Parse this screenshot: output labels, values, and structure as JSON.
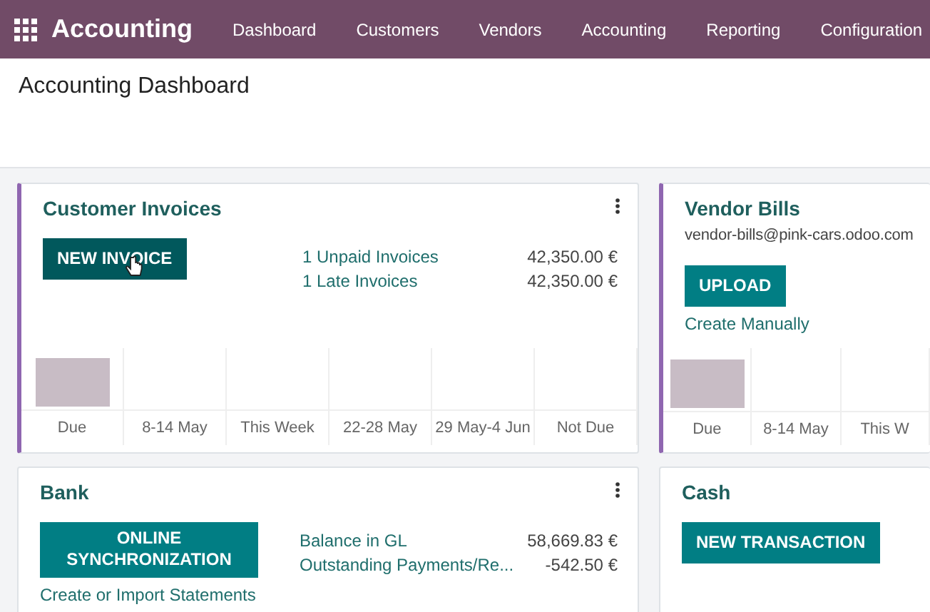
{
  "navbar": {
    "app_name": "Accounting",
    "menu": [
      "Dashboard",
      "Customers",
      "Vendors",
      "Accounting",
      "Reporting",
      "Configuration"
    ]
  },
  "page_title": "Accounting Dashboard",
  "journals": [
    {
      "name": "Customer Invoices",
      "accent": true,
      "has_menu": true,
      "buttons": [
        {
          "label": "NEW INVOICE",
          "hovered": true
        }
      ],
      "stats": [
        {
          "label": "1 Unpaid Invoices",
          "value": "42,350.00 €"
        },
        {
          "label": "1 Late Invoices",
          "value": "42,350.00 €"
        }
      ],
      "graph": [
        {
          "label": "Due",
          "bar": true
        },
        {
          "label": "8-14 May",
          "bar": false
        },
        {
          "label": "This Week",
          "bar": false
        },
        {
          "label": "22-28 May",
          "bar": false
        },
        {
          "label": "29 May-4 Jun",
          "bar": false
        },
        {
          "label": "Not Due",
          "bar": false
        }
      ]
    },
    {
      "name": "Vendor Bills",
      "subtitle": "vendor-bills@pink-cars.odoo.com",
      "accent": true,
      "buttons": [
        {
          "label": "UPLOAD",
          "hovered": false
        }
      ],
      "links": [
        "Create Manually"
      ],
      "graph": [
        {
          "label": "Due",
          "bar": true
        },
        {
          "label": "8-14 May",
          "bar": false
        },
        {
          "label": "This W",
          "bar": false
        }
      ]
    },
    {
      "name": "Bank",
      "accent": false,
      "has_menu": true,
      "buttons": [
        {
          "label": "ONLINE SYNCHRONIZATION",
          "hovered": false
        }
      ],
      "links": [
        "Create or Import Statements"
      ],
      "stats": [
        {
          "label": "Balance in GL",
          "value": "58,669.83 €"
        },
        {
          "label": "Outstanding Payments/Re...",
          "value": "-542.50 €"
        }
      ]
    },
    {
      "name": "Cash",
      "accent": false,
      "buttons": [
        {
          "label": "NEW TRANSACTION",
          "hovered": false
        }
      ]
    }
  ]
}
